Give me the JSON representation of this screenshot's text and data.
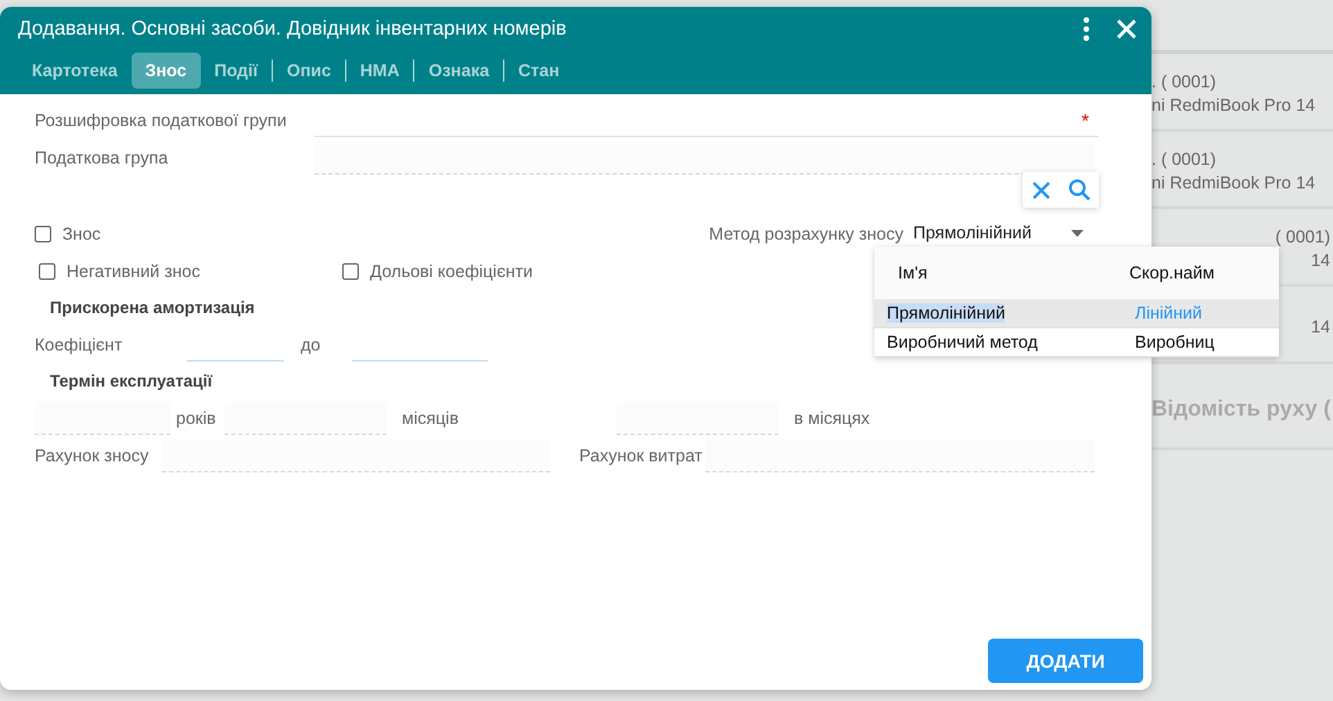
{
  "background": {
    "rows": [
      {
        "code": ". (   0001)",
        "name": "ni RedmiBook Pro 14"
      },
      {
        "code": ". (   0001)",
        "name": "ni RedmiBook Pro 14"
      },
      {
        "code": "(   0001)",
        "name": "14"
      },
      {
        "code": "",
        "name": "14"
      }
    ],
    "section_title": "Відомість руху ("
  },
  "window": {
    "title": "Додавання. Основні засоби. Довідник інвентарних номерів"
  },
  "tabs": [
    {
      "label": "Картотека",
      "selected": false
    },
    {
      "label": "Знос",
      "selected": true
    },
    {
      "label": "Події",
      "selected": false
    },
    {
      "label": "Опис",
      "selected": false
    },
    {
      "label": "НМА",
      "selected": false
    },
    {
      "label": "Ознака",
      "selected": false
    },
    {
      "label": "Стан",
      "selected": false
    }
  ],
  "form": {
    "tax_group_decoding": {
      "label": "Розшифровка податкової групи",
      "required_mark": "*"
    },
    "tax_group": {
      "label": "Податкова група"
    },
    "depreciation": {
      "label": "Знос",
      "checked": false
    },
    "method": {
      "label": "Метод розрахунку зносу",
      "value": "Прямолінійний",
      "expanded": true
    },
    "negative_depreciation": {
      "label": "Негативний знос",
      "checked": false
    },
    "share_coefficients": {
      "label": "Дольові коефіцієнти",
      "checked": false
    },
    "accelerated": {
      "title": "Прискорена амортизація",
      "coefficient_label": "Коефіцієнт",
      "to_label": "до"
    },
    "service_life": {
      "title": "Термін експлуатації",
      "years_label": "років",
      "months_label": "місяців",
      "in_months_label": "в місяцях"
    },
    "depreciation_account": {
      "label": "Рахунок зносу"
    },
    "expense_account": {
      "label": "Рахунок витрат"
    }
  },
  "dropdown": {
    "columns": [
      "Ім'я",
      "Скор.найм"
    ],
    "rows": [
      {
        "name": "Прямолінійний",
        "short": "Лінійний",
        "selected": true
      },
      {
        "name": "Виробничий метод",
        "short": "Виробниц",
        "selected": false
      }
    ]
  },
  "add_button": "ДОДАТИ"
}
